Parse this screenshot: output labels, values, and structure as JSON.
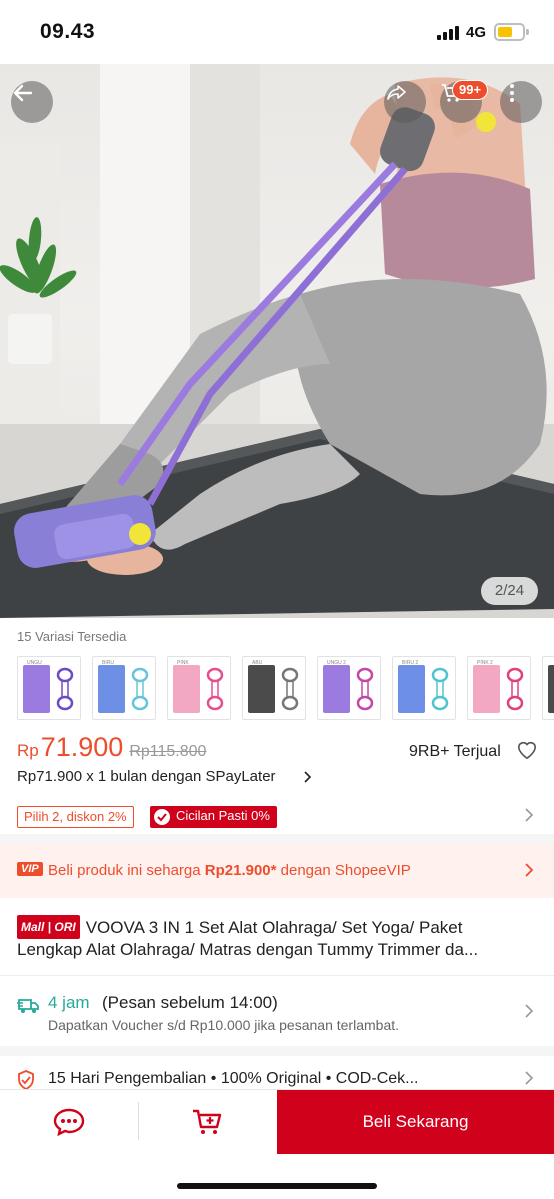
{
  "status_bar": {
    "time": "09.43",
    "network": "4G"
  },
  "gallery": {
    "page_counter": "2/24",
    "cart_badge": "99+"
  },
  "variants": {
    "title": "15 Variasi Tersedia",
    "items": [
      {
        "label": "UNGU",
        "color": "#9b7be0",
        "band_color": "#6b4cc4"
      },
      {
        "label": "BIRU",
        "color": "#6e8fe6",
        "band_color": "#68c4d8"
      },
      {
        "label": "PINK",
        "color": "#f2a7c2",
        "band_color": "#e44f8d"
      },
      {
        "label": "ABU",
        "color": "#4b4b4b",
        "band_color": "#777777"
      },
      {
        "label": "UNGU 2",
        "color": "#9b7be0",
        "band_color": "#c247a8"
      },
      {
        "label": "BIRU 2",
        "color": "#6e8fe6",
        "band_color": "#4fc4d0"
      },
      {
        "label": "PINK 2",
        "color": "#f2a7c2",
        "band_color": "#e0407e"
      },
      {
        "label": "",
        "color": "#4b4b4b",
        "band_color": "#777777"
      }
    ]
  },
  "price": {
    "currency": "Rp",
    "value": "71.900",
    "original": "Rp115.800",
    "sold": "9RB+ Terjual",
    "paylater": "Rp71.900 x 1 bulan dengan SPayLater"
  },
  "promos": {
    "bundle": "Pilih 2, diskon 2%",
    "installment": "Cicilan Pasti 0%"
  },
  "vip": {
    "logo": "VIP",
    "text_before": "Beli produk ini seharga ",
    "amount": "Rp21.900*",
    "text_after": " dengan ShopeeVIP"
  },
  "product": {
    "mall_tag": "Mall | ORI",
    "title_line1": "VOOVA 3 IN 1 Set Alat Olahraga/ Set Yoga/ Paket",
    "title_line2": "Lengkap Alat Olahraga/ Matras dengan Tummy Trimmer da..."
  },
  "shipping": {
    "time": "4 jam",
    "note": "(Pesan sebelum 14:00)",
    "sub": "Dapatkan Voucher s/d Rp10.000 jika pesanan terlambat."
  },
  "guarantee": {
    "text": "15 Hari Pengembalian  •  100% Original  •  COD-Cek..."
  },
  "bottom_bar": {
    "buy_label": "Beli Sekarang"
  },
  "colors": {
    "accent": "#ee4d2d",
    "buy": "#d0011b",
    "shipping": "#26aa99"
  }
}
